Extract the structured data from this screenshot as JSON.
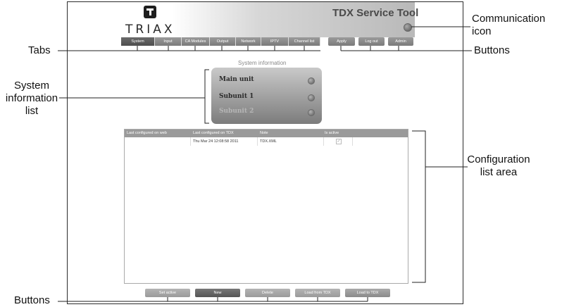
{
  "header": {
    "logo_text": "TRIAX",
    "app_title": "TDX Service Tool"
  },
  "tabs": [
    "System",
    "Input",
    "CA Modules",
    "Output",
    "Network",
    "IPTV",
    "Channel list"
  ],
  "active_tab": "System",
  "top_buttons": [
    "Apply",
    "Log out",
    "Admin"
  ],
  "system_info": {
    "title": "System information",
    "items": [
      {
        "label": "Main unit",
        "enabled": true
      },
      {
        "label": "Subunit 1",
        "enabled": true
      },
      {
        "label": "Subunit 2",
        "enabled": false
      }
    ]
  },
  "config_table": {
    "columns": [
      "Last configured on web",
      "Last configured on TDX",
      "Note",
      "Is active"
    ],
    "rows": [
      {
        "web": "",
        "tdx": "Thu Mar 24 12:08:58 2011",
        "note": "TDX.XML",
        "active": true
      }
    ]
  },
  "bottom_buttons": [
    {
      "label": "Set active",
      "state": "disabled"
    },
    {
      "label": "New",
      "state": "enabled"
    },
    {
      "label": "Delete",
      "state": "disabled"
    },
    {
      "label": "Load from TDX",
      "state": "disabled"
    },
    {
      "label": "Load to TDX",
      "state": "enabled"
    }
  ],
  "annotations": {
    "communication_icon": "Communication icon",
    "tabs": "Tabs",
    "buttons_top": "Buttons",
    "system_information_list": "System information list",
    "configuration_list_area": "Configuration list area",
    "buttons_bottom": "Buttons"
  }
}
